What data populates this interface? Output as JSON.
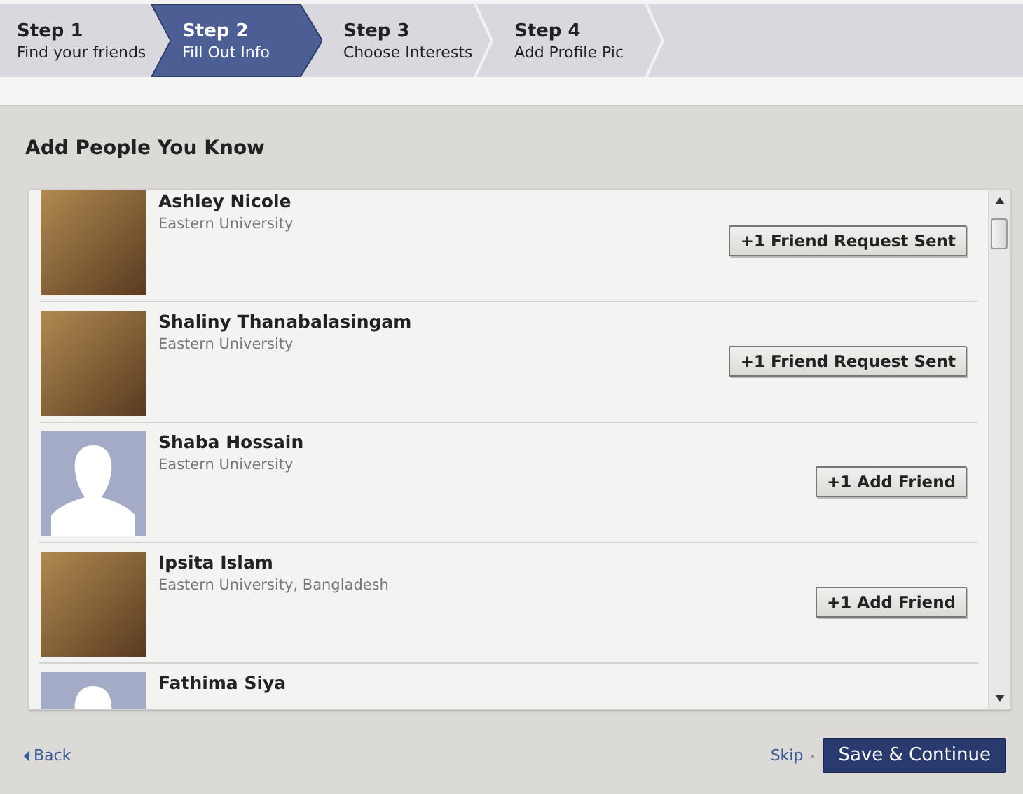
{
  "steps": [
    {
      "title": "Step 1",
      "subtitle": "Find your friends",
      "selected": false
    },
    {
      "title": "Step 2",
      "subtitle": "Fill Out Info",
      "selected": true
    },
    {
      "title": "Step 3",
      "subtitle": "Choose Interests",
      "selected": false
    },
    {
      "title": "Step 4",
      "subtitle": "Add Profile Pic",
      "selected": false
    }
  ],
  "heading": "Add People You Know",
  "people": [
    {
      "name": "Ashley Nicole",
      "network": "Eastern University",
      "kind": "photo",
      "button": "+1 Friend Request Sent"
    },
    {
      "name": "Shaliny Thanabalasingam",
      "network": "Eastern University",
      "kind": "photo",
      "button": "+1 Friend Request Sent"
    },
    {
      "name": "Shaba Hossain",
      "network": "Eastern University",
      "kind": "silhouette",
      "button": "+1 Add Friend"
    },
    {
      "name": "Ipsita Islam",
      "network": "Eastern University, Bangladesh",
      "kind": "photo",
      "button": "+1 Add Friend"
    },
    {
      "name": "Fathima Siya",
      "kind": "silhouette"
    }
  ],
  "footer": {
    "back": "Back",
    "skip": "Skip",
    "save": "Save & Continue"
  }
}
